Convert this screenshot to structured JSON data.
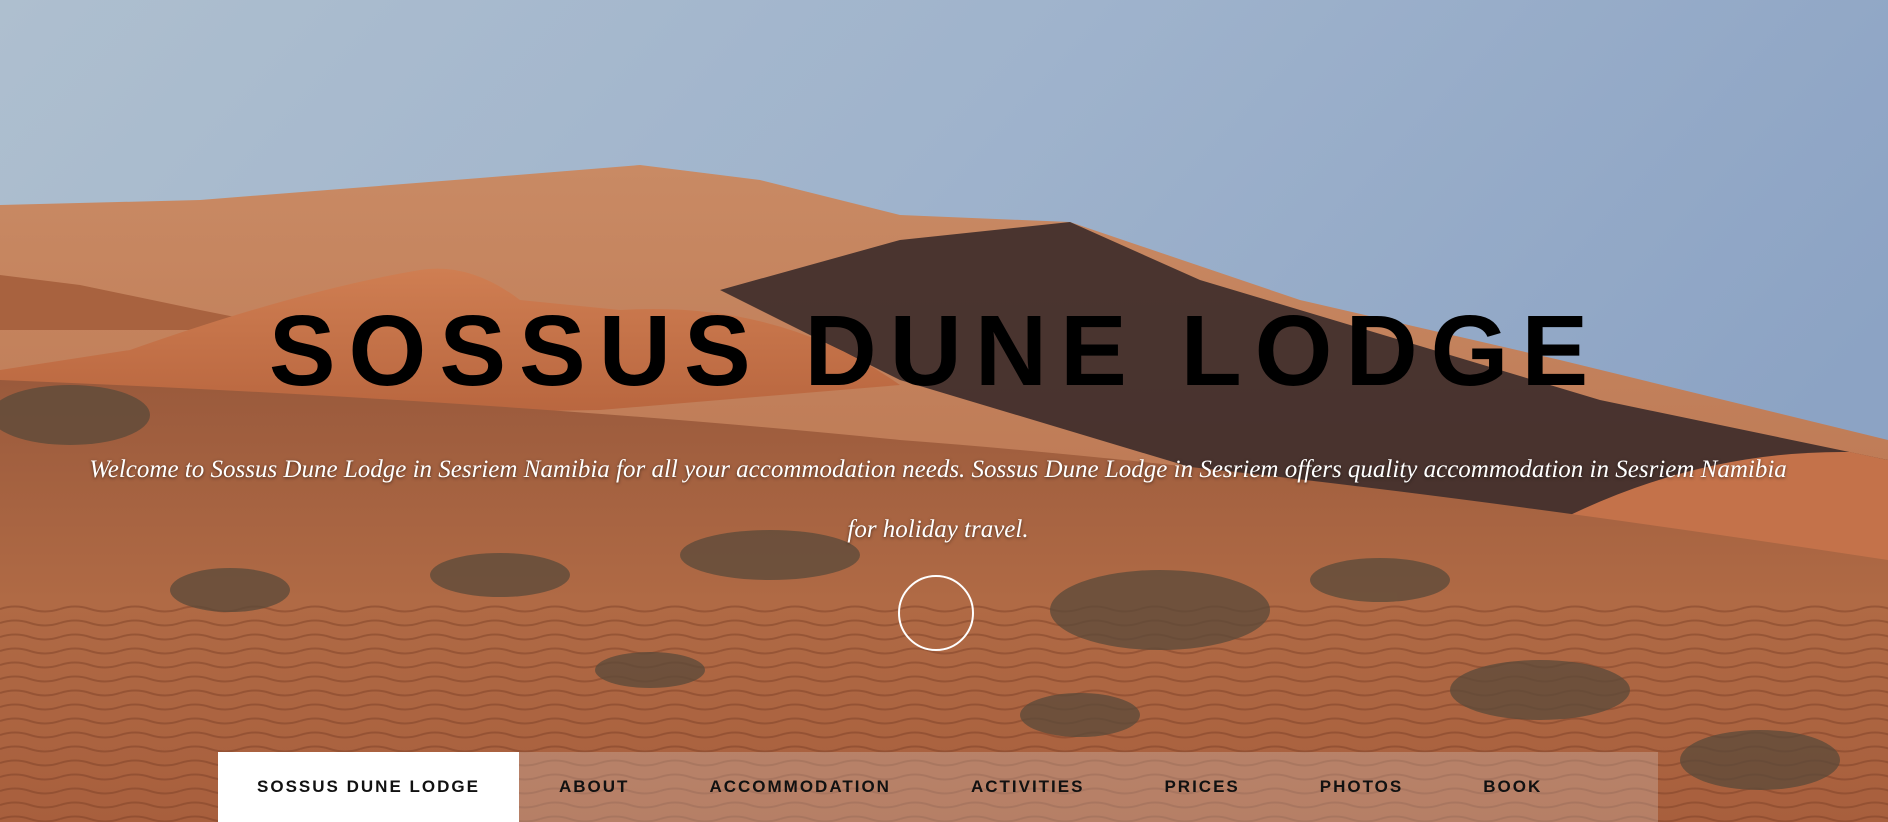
{
  "hero": {
    "title": "SOSSUS DUNE LODGE",
    "tagline": "Welcome to Sossus Dune Lodge in Sesriem Namibia for all your accommodation needs. Sossus Dune Lodge in Sesriem offers quality accommodation in Sesriem Namibia for holiday travel.",
    "background_image": "desert-dunes-landscape"
  },
  "nav": {
    "brand": "SOSSUS DUNE LODGE",
    "items": [
      {
        "label": "ABOUT"
      },
      {
        "label": "ACCOMMODATION"
      },
      {
        "label": "ACTIVITIES"
      },
      {
        "label": "PRICES"
      },
      {
        "label": "PHOTOS"
      },
      {
        "label": "BOOK"
      }
    ]
  },
  "colors": {
    "title": "#000000",
    "tagline": "#ffffff",
    "nav_brand_bg": "#ffffff",
    "sky": "#8da2bf",
    "sand": "#c0704a"
  }
}
